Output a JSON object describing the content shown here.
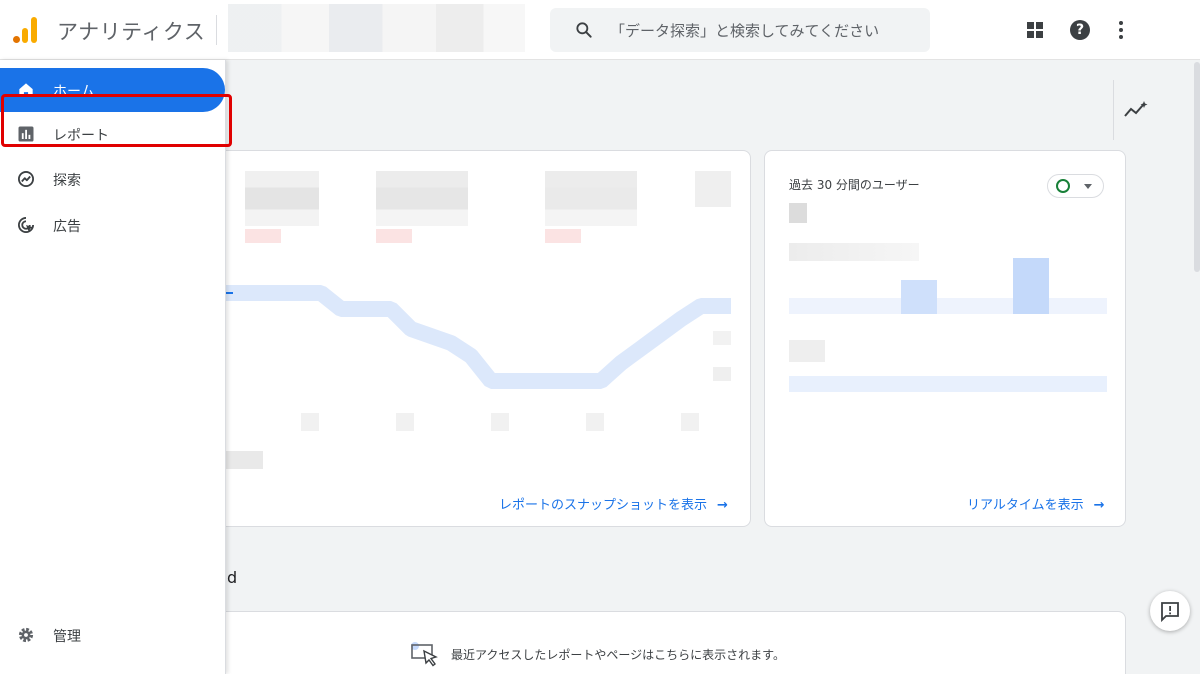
{
  "app": {
    "title": "アナリティクス"
  },
  "search": {
    "placeholder": "「データ探索」と検索してみてください"
  },
  "sidebar": {
    "items": [
      {
        "label": "ホーム",
        "icon": "home-icon",
        "active": true
      },
      {
        "label": "レポート",
        "icon": "bar-chart-icon",
        "active": false
      },
      {
        "label": "探索",
        "icon": "explore-icon",
        "active": false,
        "highlighted": true
      },
      {
        "label": "広告",
        "icon": "ads-icon",
        "active": false
      }
    ],
    "admin": {
      "label": "管理",
      "icon": "gear-icon"
    }
  },
  "overview_card": {
    "link_label": "レポートのスナップショットを表示"
  },
  "realtime_card": {
    "title": "過去 30 分間のユーザー",
    "link_label": "リアルタイムを表示"
  },
  "recent": {
    "heading_fragment": "d",
    "message": "最近アクセスしたレポートやページはこちらに表示されます。"
  },
  "colors": {
    "accent": "#1a73e8",
    "highlight": "#e00000",
    "logo_orange": "#f9ab00"
  }
}
